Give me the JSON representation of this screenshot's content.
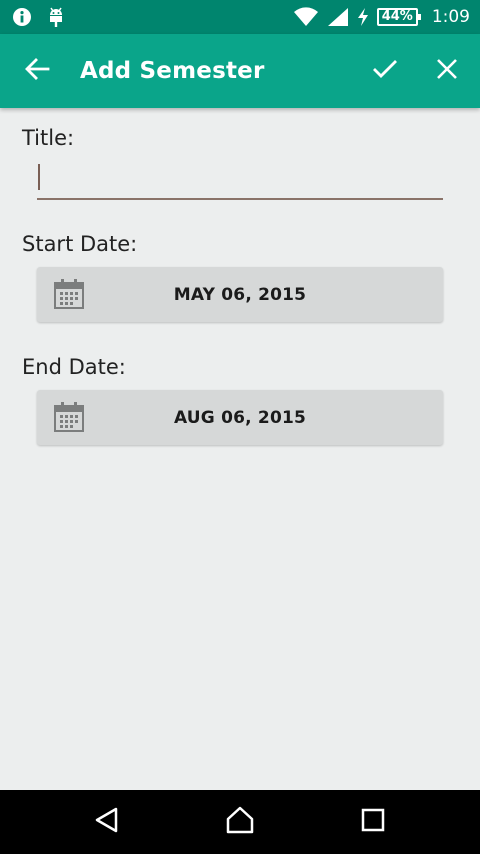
{
  "status_bar": {
    "battery": "44%",
    "time": "1:09",
    "icons": [
      "info-icon",
      "android-debug-icon",
      "wifi-icon",
      "signal-icon",
      "charging-bolt-icon",
      "battery-icon"
    ]
  },
  "app_bar": {
    "title": "Add Semester",
    "back_icon": "arrow-left-icon",
    "confirm_icon": "check-icon",
    "close_icon": "close-icon"
  },
  "form": {
    "title_label": "Title:",
    "title_value": "",
    "start_label": "Start Date:",
    "start_date": "MAY 06, 2015",
    "end_label": "End Date:",
    "end_date": "AUG 06, 2015",
    "calendar_icon": "calendar-icon"
  },
  "nav_bar": {
    "icons": [
      "back-triangle-icon",
      "home-icon",
      "recents-icon"
    ]
  },
  "colors": {
    "status_bar": "#00856e",
    "app_bar": "#0aa58a",
    "background": "#eceeee",
    "date_button": "#d6d8d8",
    "input_underline": "#8a7369"
  }
}
